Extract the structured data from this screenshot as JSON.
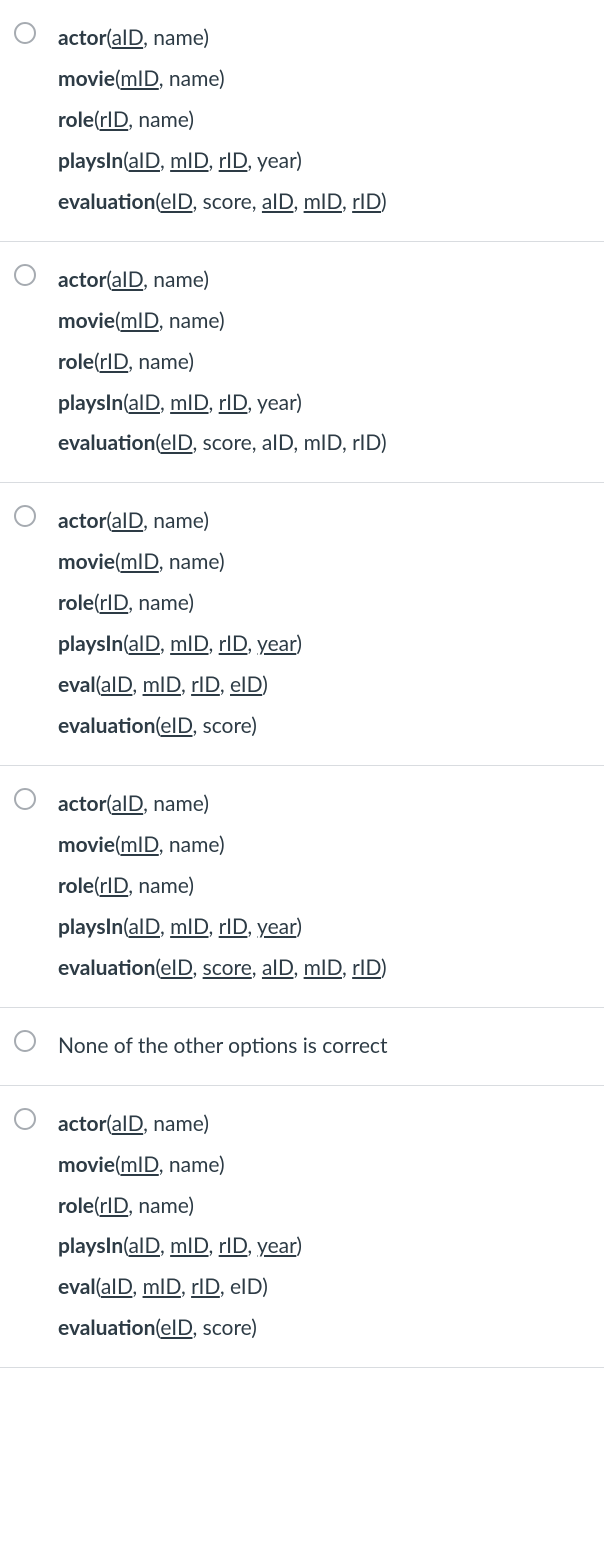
{
  "options": [
    {
      "lines": [
        [
          {
            "t": "actor",
            "b": true
          },
          {
            "t": "("
          },
          {
            "t": "aID",
            "u": true
          },
          {
            "t": ", name)"
          }
        ],
        [
          {
            "t": "movie",
            "b": true
          },
          {
            "t": "("
          },
          {
            "t": "mID",
            "u": true
          },
          {
            "t": ", name)"
          }
        ],
        [
          {
            "t": "role",
            "b": true
          },
          {
            "t": "("
          },
          {
            "t": "rID",
            "u": true
          },
          {
            "t": ", name)"
          }
        ],
        [
          {
            "t": "playsIn",
            "b": true
          },
          {
            "t": "("
          },
          {
            "t": "aID",
            "u": true
          },
          {
            "t": ", "
          },
          {
            "t": "mID",
            "u": true
          },
          {
            "t": ", "
          },
          {
            "t": "rID",
            "u": true
          },
          {
            "t": ", year)"
          }
        ],
        [
          {
            "t": "evaluation",
            "b": true
          },
          {
            "t": "("
          },
          {
            "t": "eID",
            "u": true
          },
          {
            "t": ", score, "
          },
          {
            "t": "aID",
            "u": true
          },
          {
            "t": ", "
          },
          {
            "t": "mID",
            "u": true
          },
          {
            "t": ", "
          },
          {
            "t": "rID",
            "u": true
          },
          {
            "t": ")"
          }
        ]
      ]
    },
    {
      "lines": [
        [
          {
            "t": "actor",
            "b": true
          },
          {
            "t": "("
          },
          {
            "t": "aID",
            "u": true
          },
          {
            "t": ", name)"
          }
        ],
        [
          {
            "t": "movie",
            "b": true
          },
          {
            "t": "("
          },
          {
            "t": "mID",
            "u": true
          },
          {
            "t": ", name)"
          }
        ],
        [
          {
            "t": "role",
            "b": true
          },
          {
            "t": "("
          },
          {
            "t": "rID",
            "u": true
          },
          {
            "t": ", name)"
          }
        ],
        [
          {
            "t": "playsIn",
            "b": true
          },
          {
            "t": "("
          },
          {
            "t": "aID",
            "u": true
          },
          {
            "t": ", "
          },
          {
            "t": "mID",
            "u": true
          },
          {
            "t": ", "
          },
          {
            "t": "rID",
            "u": true
          },
          {
            "t": ", year)"
          }
        ],
        [
          {
            "t": "evaluation",
            "b": true
          },
          {
            "t": "("
          },
          {
            "t": "eID",
            "u": true
          },
          {
            "t": ", score, aID, mID, rID)"
          }
        ]
      ]
    },
    {
      "lines": [
        [
          {
            "t": "actor",
            "b": true
          },
          {
            "t": "("
          },
          {
            "t": "aID",
            "u": true
          },
          {
            "t": ", name)"
          }
        ],
        [
          {
            "t": "movie",
            "b": true
          },
          {
            "t": "("
          },
          {
            "t": "mID",
            "u": true
          },
          {
            "t": ", name)"
          }
        ],
        [
          {
            "t": "role",
            "b": true
          },
          {
            "t": "("
          },
          {
            "t": "rID",
            "u": true
          },
          {
            "t": ", name)"
          }
        ],
        [
          {
            "t": "playsIn",
            "b": true
          },
          {
            "t": "("
          },
          {
            "t": "aID",
            "u": true
          },
          {
            "t": ", "
          },
          {
            "t": "mID",
            "u": true
          },
          {
            "t": ", "
          },
          {
            "t": "rID",
            "u": true
          },
          {
            "t": ", "
          },
          {
            "t": "year",
            "u": true
          },
          {
            "t": ")"
          }
        ],
        [
          {
            "t": "eval",
            "b": true
          },
          {
            "t": "("
          },
          {
            "t": "aID",
            "u": true
          },
          {
            "t": ", "
          },
          {
            "t": "mID",
            "u": true
          },
          {
            "t": ", "
          },
          {
            "t": "rID",
            "u": true
          },
          {
            "t": ", "
          },
          {
            "t": "eID",
            "u": true
          },
          {
            "t": ")"
          }
        ],
        [
          {
            "t": "evaluation",
            "b": true
          },
          {
            "t": "("
          },
          {
            "t": "eID",
            "u": true
          },
          {
            "t": ", score)"
          }
        ]
      ]
    },
    {
      "lines": [
        [
          {
            "t": "actor",
            "b": true
          },
          {
            "t": "("
          },
          {
            "t": "aID",
            "u": true
          },
          {
            "t": ", name)"
          }
        ],
        [
          {
            "t": "movie",
            "b": true
          },
          {
            "t": "("
          },
          {
            "t": "mID",
            "u": true
          },
          {
            "t": ", name)"
          }
        ],
        [
          {
            "t": "role",
            "b": true
          },
          {
            "t": "("
          },
          {
            "t": "rID",
            "u": true
          },
          {
            "t": ", name)"
          }
        ],
        [
          {
            "t": "playsIn",
            "b": true
          },
          {
            "t": "("
          },
          {
            "t": "aID",
            "u": true
          },
          {
            "t": ", "
          },
          {
            "t": "mID",
            "u": true
          },
          {
            "t": ", "
          },
          {
            "t": "rID",
            "u": true
          },
          {
            "t": ", "
          },
          {
            "t": "year",
            "u": true
          },
          {
            "t": ")"
          }
        ],
        [
          {
            "t": "evaluation",
            "b": true
          },
          {
            "t": "("
          },
          {
            "t": "eID",
            "u": true
          },
          {
            "t": ", "
          },
          {
            "t": "score",
            "u": true
          },
          {
            "t": ", "
          },
          {
            "t": "aID",
            "u": true
          },
          {
            "t": ", "
          },
          {
            "t": "mID",
            "u": true
          },
          {
            "t": ", "
          },
          {
            "t": "rID",
            "u": true
          },
          {
            "t": ")"
          }
        ]
      ]
    },
    {
      "lines": [
        [
          {
            "t": "None of the other options is correct"
          }
        ]
      ]
    },
    {
      "lines": [
        [
          {
            "t": "actor",
            "b": true
          },
          {
            "t": "("
          },
          {
            "t": "aID",
            "u": true
          },
          {
            "t": ", name)"
          }
        ],
        [
          {
            "t": "movie",
            "b": true
          },
          {
            "t": "("
          },
          {
            "t": "mID",
            "u": true
          },
          {
            "t": ", name)"
          }
        ],
        [
          {
            "t": "role",
            "b": true
          },
          {
            "t": "("
          },
          {
            "t": "rID",
            "u": true
          },
          {
            "t": ", name)"
          }
        ],
        [
          {
            "t": "playsIn",
            "b": true
          },
          {
            "t": "("
          },
          {
            "t": "aID",
            "u": true
          },
          {
            "t": ", "
          },
          {
            "t": "mID",
            "u": true
          },
          {
            "t": ", "
          },
          {
            "t": "rID",
            "u": true
          },
          {
            "t": ", "
          },
          {
            "t": "year",
            "u": true
          },
          {
            "t": ")"
          }
        ],
        [
          {
            "t": "eval",
            "b": true
          },
          {
            "t": "("
          },
          {
            "t": "aID",
            "u": true
          },
          {
            "t": ", "
          },
          {
            "t": "mID",
            "u": true
          },
          {
            "t": ", "
          },
          {
            "t": "rID",
            "u": true
          },
          {
            "t": ", eID)"
          }
        ],
        [
          {
            "t": "evaluation",
            "b": true
          },
          {
            "t": "("
          },
          {
            "t": "eID",
            "u": true
          },
          {
            "t": ", score)"
          }
        ]
      ]
    }
  ]
}
